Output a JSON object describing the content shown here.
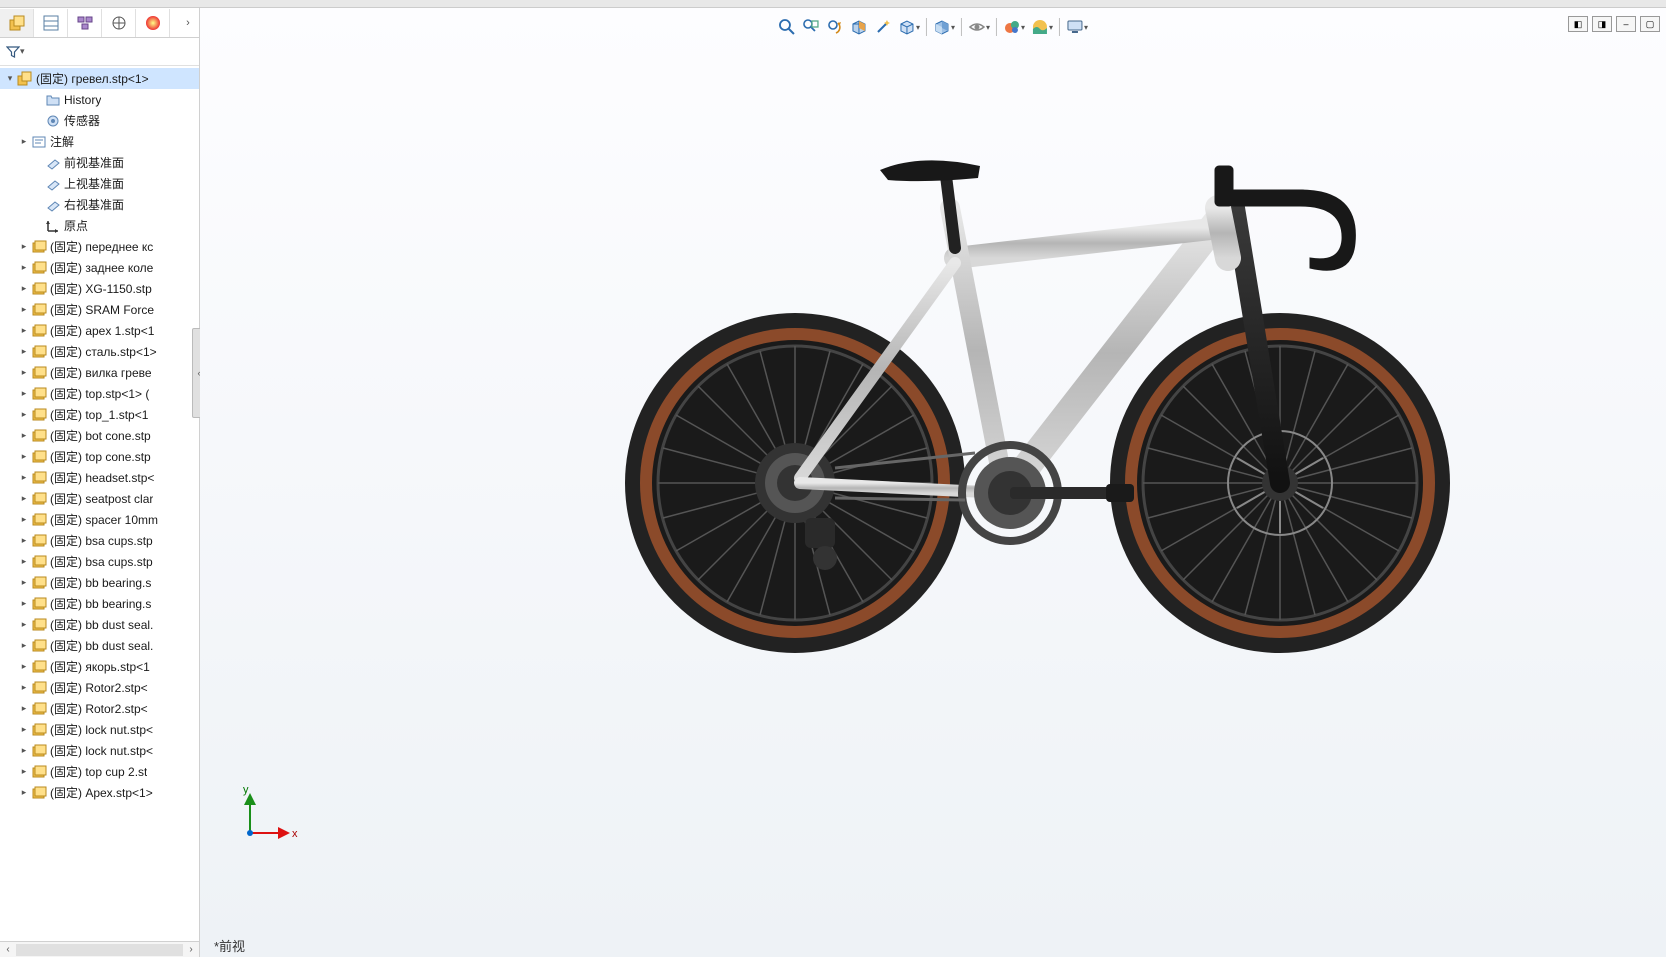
{
  "status_text": "*前视",
  "triad": {
    "x_label": "x",
    "y_label": "y"
  },
  "left_tabs": {
    "feature_manager": "feature-manager",
    "property_manager": "property-manager",
    "config_manager": "configuration-manager",
    "dimxpert": "dimxpert",
    "appearances": "appearances"
  },
  "tree": {
    "root": {
      "label": "(固定) гревел.stp<1>"
    },
    "core": [
      {
        "kind": "history",
        "label": "History"
      },
      {
        "kind": "sensor",
        "label": "传感器"
      },
      {
        "kind": "annot",
        "label": "注解",
        "expandable": true
      },
      {
        "kind": "plane",
        "label": "前视基准面"
      },
      {
        "kind": "plane",
        "label": "上视基准面"
      },
      {
        "kind": "plane",
        "label": "右视基准面"
      },
      {
        "kind": "origin",
        "label": "原点"
      }
    ],
    "parts": [
      "(固定) переднее кс",
      "(固定) заднее коле",
      "(固定) XG-1150.stp",
      "(固定) SRAM Force",
      "(固定) apex 1.stp<1",
      "(固定) сталь.stp<1>",
      "(固定) вилка греве",
      "(固定) top.stp<1> (",
      "(固定) top_1.stp<1",
      "(固定) bot cone.stp",
      "(固定) top cone.stp",
      "(固定) headset.stp<",
      "(固定) seatpost clar",
      "(固定) spacer 10mm",
      "(固定) bsa cups.stp",
      "(固定) bsa cups.stp",
      "(固定) bb bearing.s",
      "(固定) bb bearing.s",
      "(固定) bb dust seal.",
      "(固定) bb dust seal.",
      "(固定) якорь.stp<1",
      "(固定) Rotor2.stp<",
      "(固定) Rotor2.stp<",
      "(固定) lock nut.stp<",
      "(固定) lock nut.stp<",
      "(固定) top cup  2.st",
      "(固定) Apex.stp<1>"
    ]
  },
  "view_toolbar": [
    {
      "name": "zoom-to-fit-icon",
      "kind": "magnifier"
    },
    {
      "name": "zoom-to-area-icon",
      "kind": "magnifier-box"
    },
    {
      "name": "previous-view-icon",
      "kind": "magnifier-arrow"
    },
    {
      "name": "section-view-icon",
      "kind": "cube-cut"
    },
    {
      "name": "dynamic-preview-icon",
      "kind": "wand"
    },
    {
      "name": "view-orientation-icon",
      "kind": "cube",
      "drop": true
    },
    {
      "sep": true
    },
    {
      "name": "display-style-icon",
      "kind": "cube-shaded",
      "drop": true
    },
    {
      "sep": true
    },
    {
      "name": "hide-show-icon",
      "kind": "eye",
      "drop": true
    },
    {
      "sep": true
    },
    {
      "name": "edit-appearance-icon",
      "kind": "sphere-multi",
      "drop": true
    },
    {
      "name": "apply-scene-icon",
      "kind": "sphere-landscape",
      "drop": true
    },
    {
      "sep": true
    },
    {
      "name": "view-settings-icon",
      "kind": "monitor",
      "drop": true
    }
  ],
  "win_buttons": [
    {
      "name": "tile-left-icon",
      "glyph": "◧"
    },
    {
      "name": "tile-right-icon",
      "glyph": "◨"
    },
    {
      "name": "minimize-icon",
      "glyph": "–"
    },
    {
      "name": "maximize-icon",
      "glyph": "▢"
    }
  ]
}
